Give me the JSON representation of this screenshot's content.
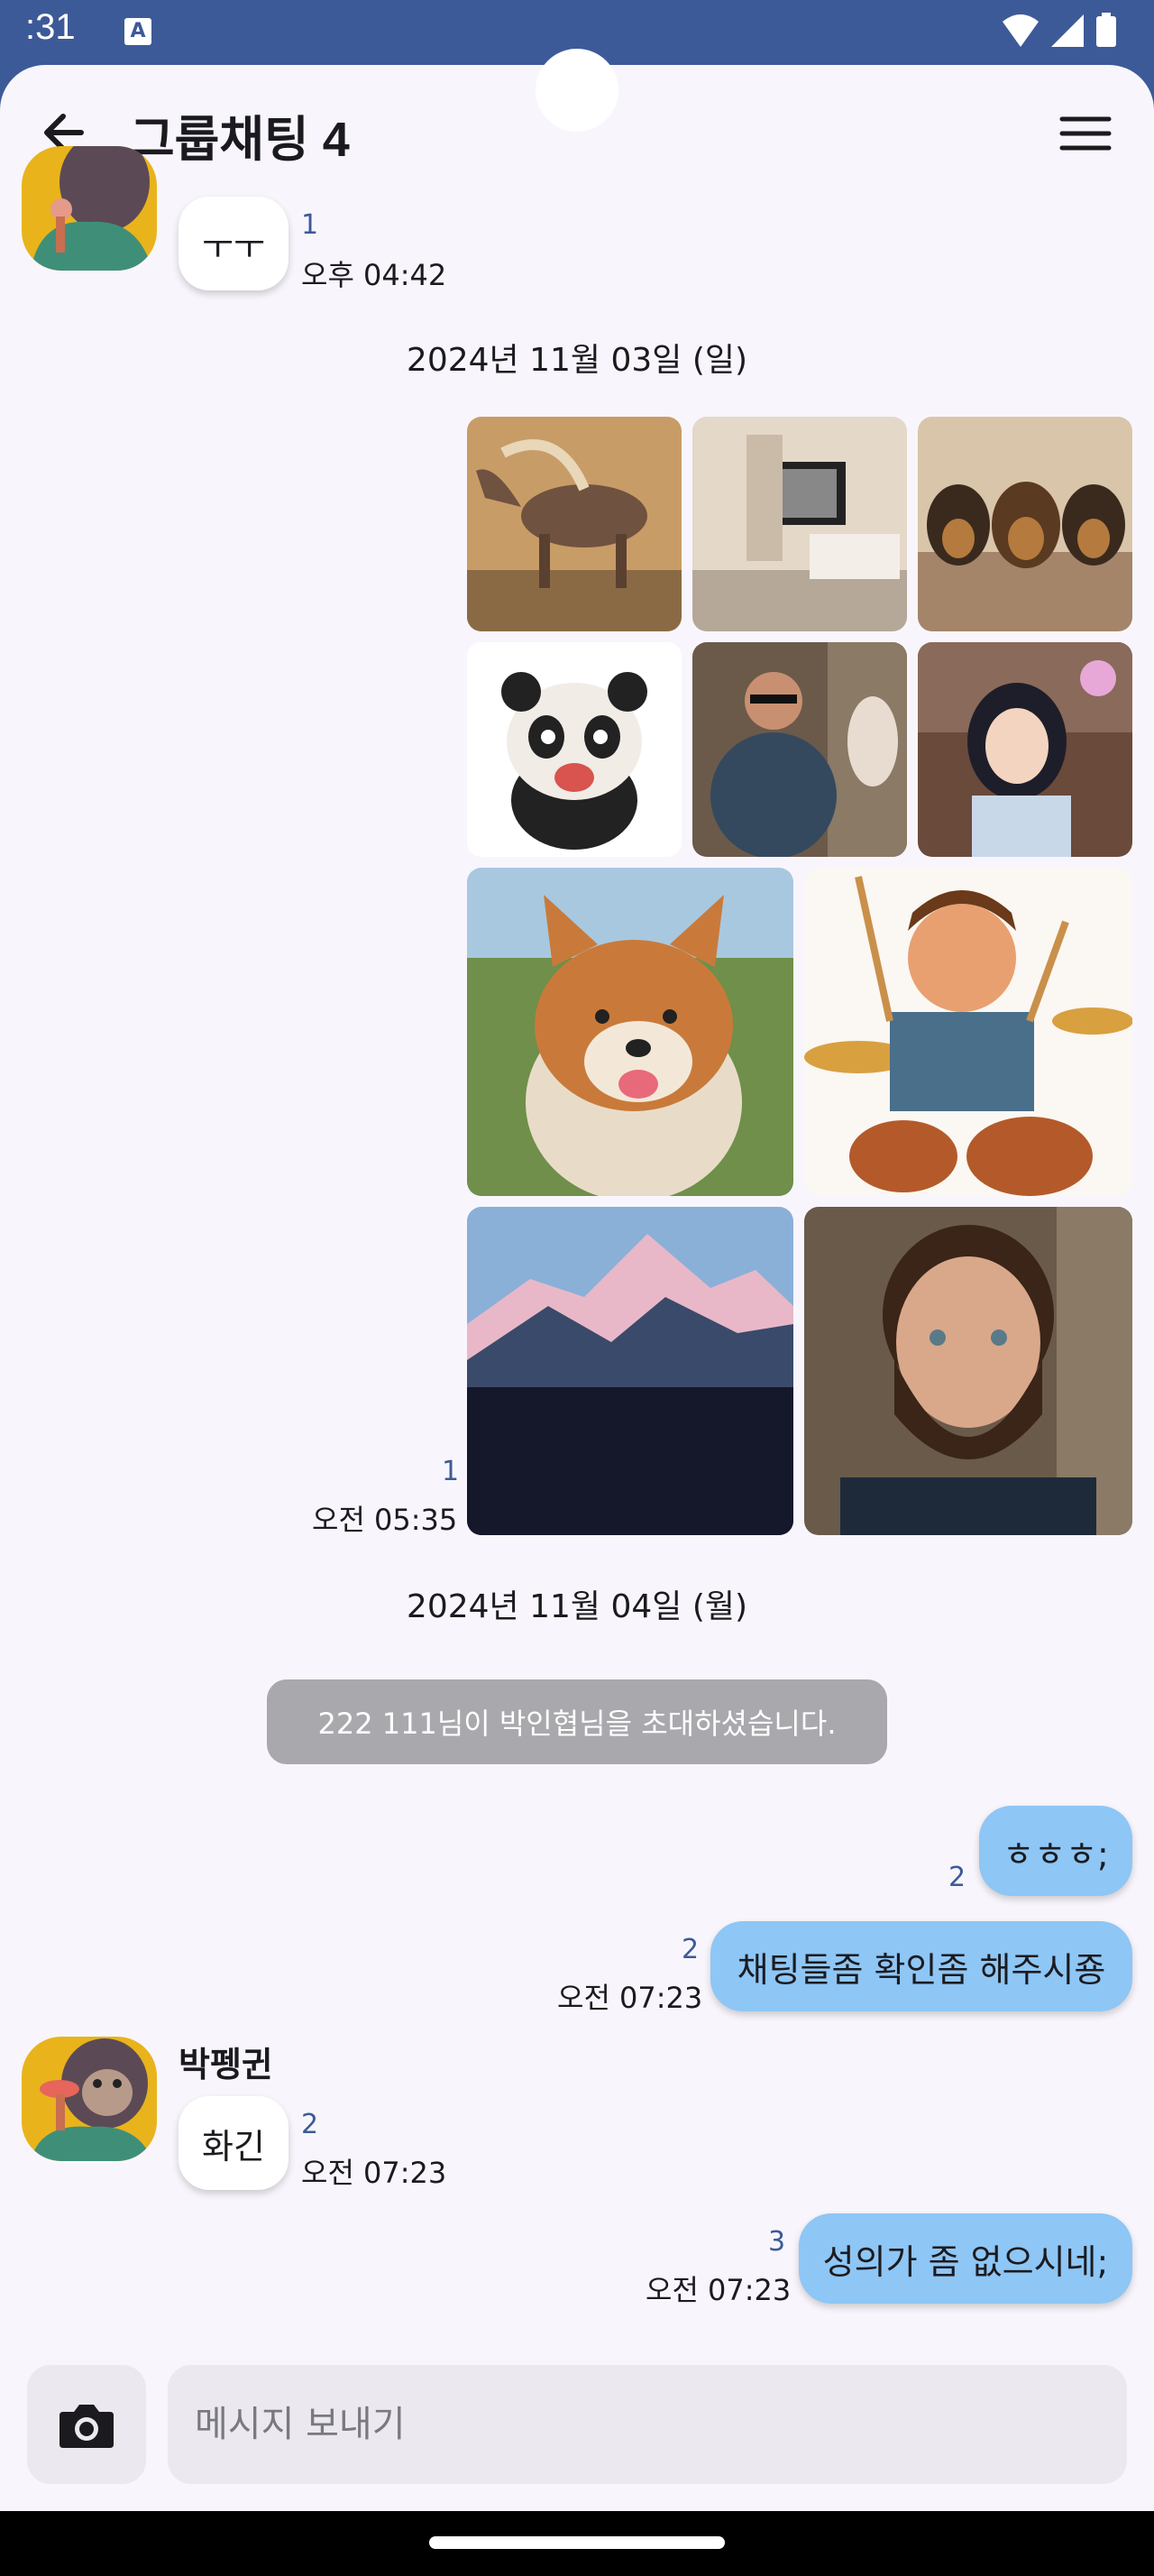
{
  "status_bar": {
    "time": ":31",
    "app_icon_letter": "A"
  },
  "app_bar": {
    "title": "그룹채팅 4",
    "back_icon": "arrow-left-icon",
    "menu_icon": "hamburger-menu-icon"
  },
  "messages": {
    "m1": {
      "text": "ㅜㅜ",
      "unread": "1",
      "time": "오후 04:42"
    },
    "date1": "2024년 11월 03일 (일)",
    "photos": {
      "unread": "1",
      "time": "오전 05:35"
    },
    "date2": "2024년 11월 04일 (월)",
    "system": "222 111님이 박인협님을 초대하셨습니다.",
    "m2": {
      "text": "ㅎㅎㅎ;",
      "unread": "2"
    },
    "m3": {
      "text": "채팅들좀 확인좀 해주시죵",
      "unread": "2",
      "time": "오전 07:23"
    },
    "sender": "박펭귄",
    "m4": {
      "text": "화긴",
      "unread": "2",
      "time": "오전 07:23"
    },
    "m5": {
      "text": "성의가 좀 없으시네;",
      "unread": "3",
      "time": "오전 07:23"
    }
  },
  "composer": {
    "placeholder": "메시지 보내기",
    "camera_icon": "camera-icon"
  },
  "colors": {
    "status_bar": "#3d5a98",
    "outgoing_bubble": "#8ec6f5",
    "background": "#f8f6fc",
    "unread_count": "#3d5a98",
    "system_message": "#a9a8ad"
  }
}
